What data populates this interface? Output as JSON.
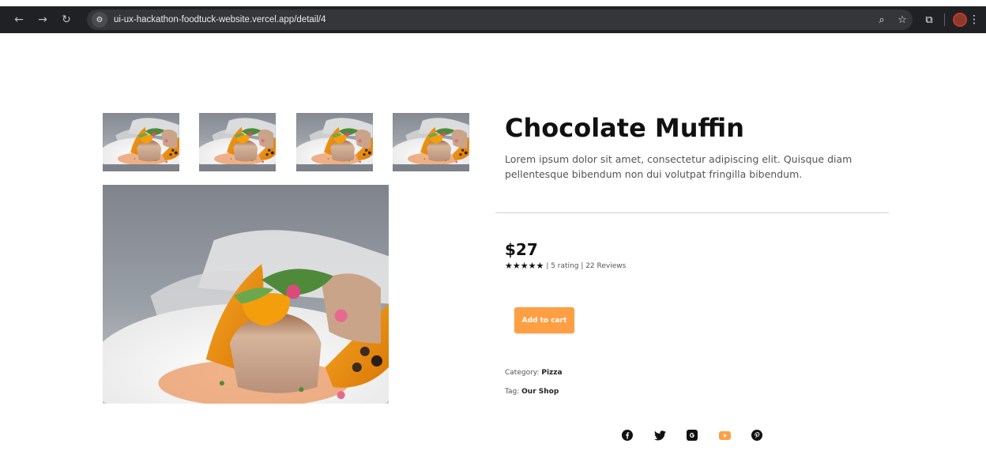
{
  "browser": {
    "url": "ui-ux-hackathon-foodtuck-website.vercel.app/detail/4",
    "icons": [
      "back-icon",
      "forward-icon",
      "reload-icon",
      "site-info-icon",
      "zoom-icon",
      "bookmark-star-icon",
      "extensions-icon",
      "profile-avatar",
      "menu-icon"
    ]
  },
  "product": {
    "title": "Chocolate Muffin",
    "description": "Lorem ipsum dolor sit amet, consectetur adipiscing elit. Quisque diam pellentesque bibendum non dui volutpat fringilla bibendum.",
    "price": "$27",
    "stars": "★★★★★",
    "rating_text": "| 5 rating | 22 Reviews",
    "add_to_cart": "Add to cart",
    "category_label": "Category:",
    "category_value": "Pizza",
    "tag_label": "Tag:",
    "tag_value": "Our Shop"
  },
  "gallery": {
    "thumbnail_count": 4
  },
  "social": [
    "facebook-icon",
    "twitter-icon",
    "google-icon",
    "youtube-icon",
    "pinterest-icon"
  ],
  "colors": {
    "accent": "#ff9f43",
    "chrome_bg": "#202124",
    "omnibox_bg": "#35363a",
    "youtube": "#ff9f43"
  }
}
